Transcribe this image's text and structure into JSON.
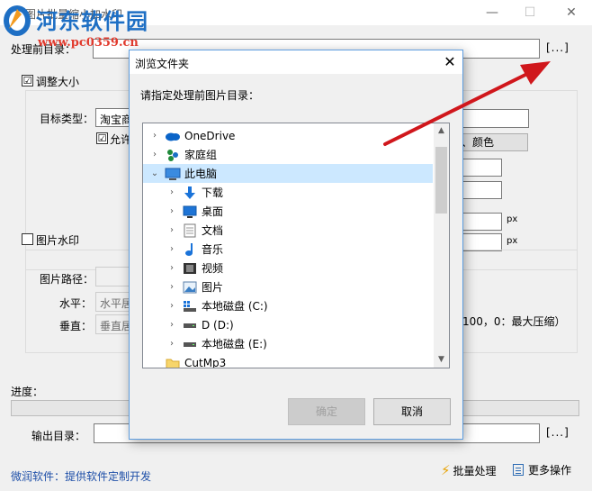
{
  "window": {
    "title": "图片批量缩小加水印",
    "minimize": "—",
    "maximize": "☐",
    "close": "✕"
  },
  "watermark": {
    "site_name": "河东软件园",
    "site_url": "www.pc0359.cn"
  },
  "main": {
    "source_dir_label": "处理前目录：",
    "browse_label": "[...]",
    "resize_checkbox_label": "调整大小",
    "resize_checked": "☑",
    "target_type_label": "目标类型：",
    "target_type_value": "淘宝商",
    "allow_checkbox_label": "允许",
    "allow_checked": "☑",
    "color_button_label": "、颜色",
    "unit_px_1": "px",
    "unit_px_2": "px",
    "watermark_checkbox_label": "图片水印",
    "image_path_label": "图片路径：",
    "horizontal_label": "水平：",
    "horizontal_value": "水平居",
    "vertical_label": "垂直：",
    "vertical_value": "垂直居",
    "compress_hint": "100，0：最大压缩）",
    "progress_label": "进度：",
    "output_dir_label": "输出目录：",
    "output_browse_label": "[...]",
    "footer_left": "微润软件：提供软件定制开发",
    "batch_button_label": "批量处理",
    "more_button_label": "更多操作"
  },
  "dialog": {
    "title": "浏览文件夹",
    "close": "✕",
    "prompt": "请指定处理前图片目录：",
    "ok_label": "确定",
    "cancel_label": "取消",
    "tree": [
      {
        "label": "OneDrive",
        "icon": "cloud-icon",
        "expand": "›",
        "level": 0
      },
      {
        "label": "家庭组",
        "icon": "homegroup-icon",
        "expand": "›",
        "level": 0
      },
      {
        "label": "此电脑",
        "icon": "computer-icon",
        "expand": "⌄",
        "level": 0,
        "selected": true
      },
      {
        "label": "下载",
        "icon": "download-icon",
        "expand": "›",
        "level": 1
      },
      {
        "label": "桌面",
        "icon": "desktop-icon",
        "expand": "›",
        "level": 1
      },
      {
        "label": "文档",
        "icon": "document-icon",
        "expand": "›",
        "level": 1
      },
      {
        "label": "音乐",
        "icon": "music-icon",
        "expand": "›",
        "level": 1
      },
      {
        "label": "视频",
        "icon": "video-icon",
        "expand": "›",
        "level": 1
      },
      {
        "label": "图片",
        "icon": "picture-icon",
        "expand": "›",
        "level": 1
      },
      {
        "label": "本地磁盘 (C:)",
        "icon": "windows-drive-icon",
        "expand": "›",
        "level": 1
      },
      {
        "label": "D (D:)",
        "icon": "drive-icon",
        "expand": "›",
        "level": 1
      },
      {
        "label": "本地磁盘 (E:)",
        "icon": "drive-icon",
        "expand": "›",
        "level": 1
      },
      {
        "label": "CutMp3",
        "icon": "folder-icon",
        "expand": "",
        "level": 0
      }
    ]
  },
  "colors": {
    "accent": "#0078d7",
    "arrow": "#d0171c",
    "selection": "#cce8ff"
  }
}
